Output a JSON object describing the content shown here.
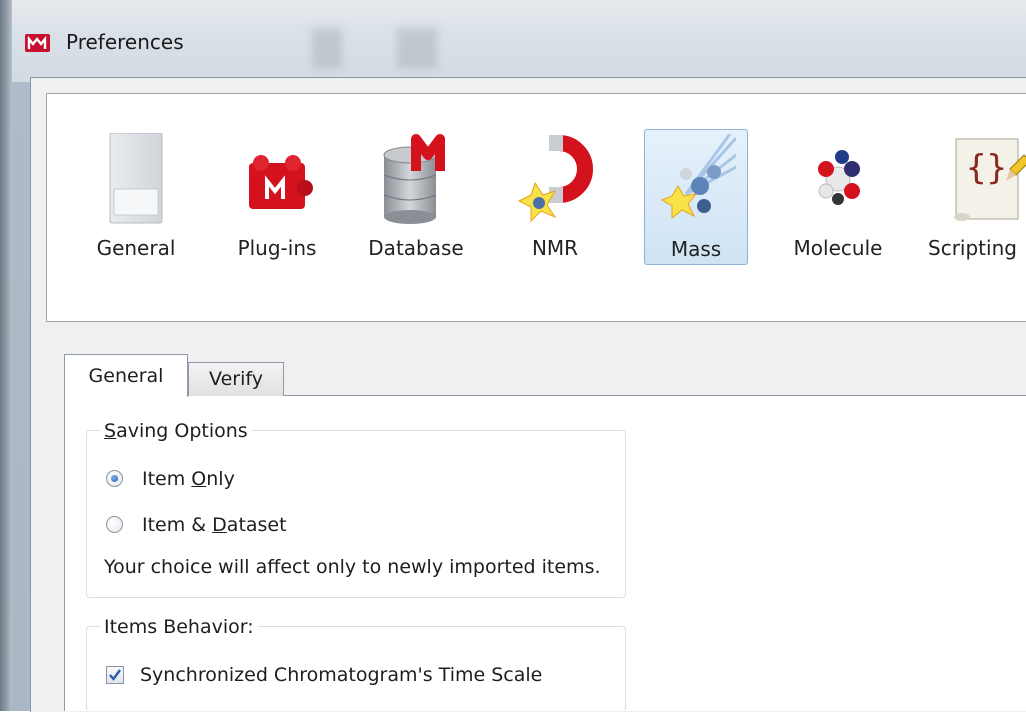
{
  "window": {
    "title": "Preferences"
  },
  "toolbar": {
    "items": [
      {
        "label": "General",
        "icon": "general-icon"
      },
      {
        "label": "Plug-ins",
        "icon": "plugins-icon"
      },
      {
        "label": "Database",
        "icon": "database-icon"
      },
      {
        "label": "NMR",
        "icon": "nmr-magnet-icon"
      },
      {
        "label": "Mass",
        "icon": "mass-spectrometry-icon",
        "selected": true
      },
      {
        "label": "Molecule",
        "icon": "molecule-icon"
      },
      {
        "label": "Scripting",
        "icon": "scripting-icon"
      }
    ]
  },
  "tabs": [
    {
      "label": "General",
      "active": true
    },
    {
      "label": "Verify",
      "active": false
    }
  ],
  "saving_options": {
    "legend_pre": "",
    "legend_ul": "S",
    "legend_post": "aving Options",
    "item_only": {
      "pre": "Item ",
      "ul": "O",
      "post": "nly",
      "checked": true
    },
    "item_dataset": {
      "pre": "Item & ",
      "ul": "D",
      "post": "ataset",
      "checked": false
    },
    "note": "Your choice will affect only to newly imported  items."
  },
  "items_behavior": {
    "legend": "Items Behavior:",
    "sync_label": "Synchronized Chromatogram's Time Scale",
    "sync_checked": true
  },
  "colors": {
    "selection_bg": "#cfe3f5",
    "selection_border": "#8fb3d6",
    "radio_dot": "#1f5fae",
    "app_icon_red": "#c8102e"
  }
}
